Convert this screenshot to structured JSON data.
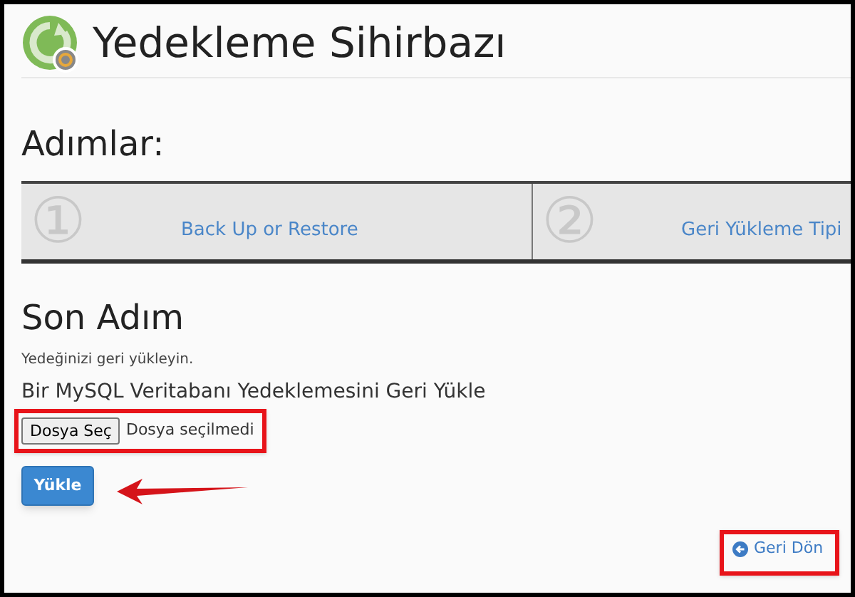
{
  "header": {
    "title": "Yedekleme Sihirbazı"
  },
  "steps": {
    "heading": "Adımlar:",
    "items": [
      {
        "number": "①",
        "label": "Back Up or Restore"
      },
      {
        "number": "②",
        "label": "Geri Yükleme Tipi"
      }
    ]
  },
  "section": {
    "title": "Son Adım",
    "description": "Yedeğinizi geri yükleyin.",
    "subtitle": "Bir MySQL Veritabanı Yedeklemesini Geri Yükle"
  },
  "file_input": {
    "button": "Dosya Seç",
    "status": "Dosya seçilmedi"
  },
  "upload_button": "Yükle",
  "back_link": "Geri Dön"
}
